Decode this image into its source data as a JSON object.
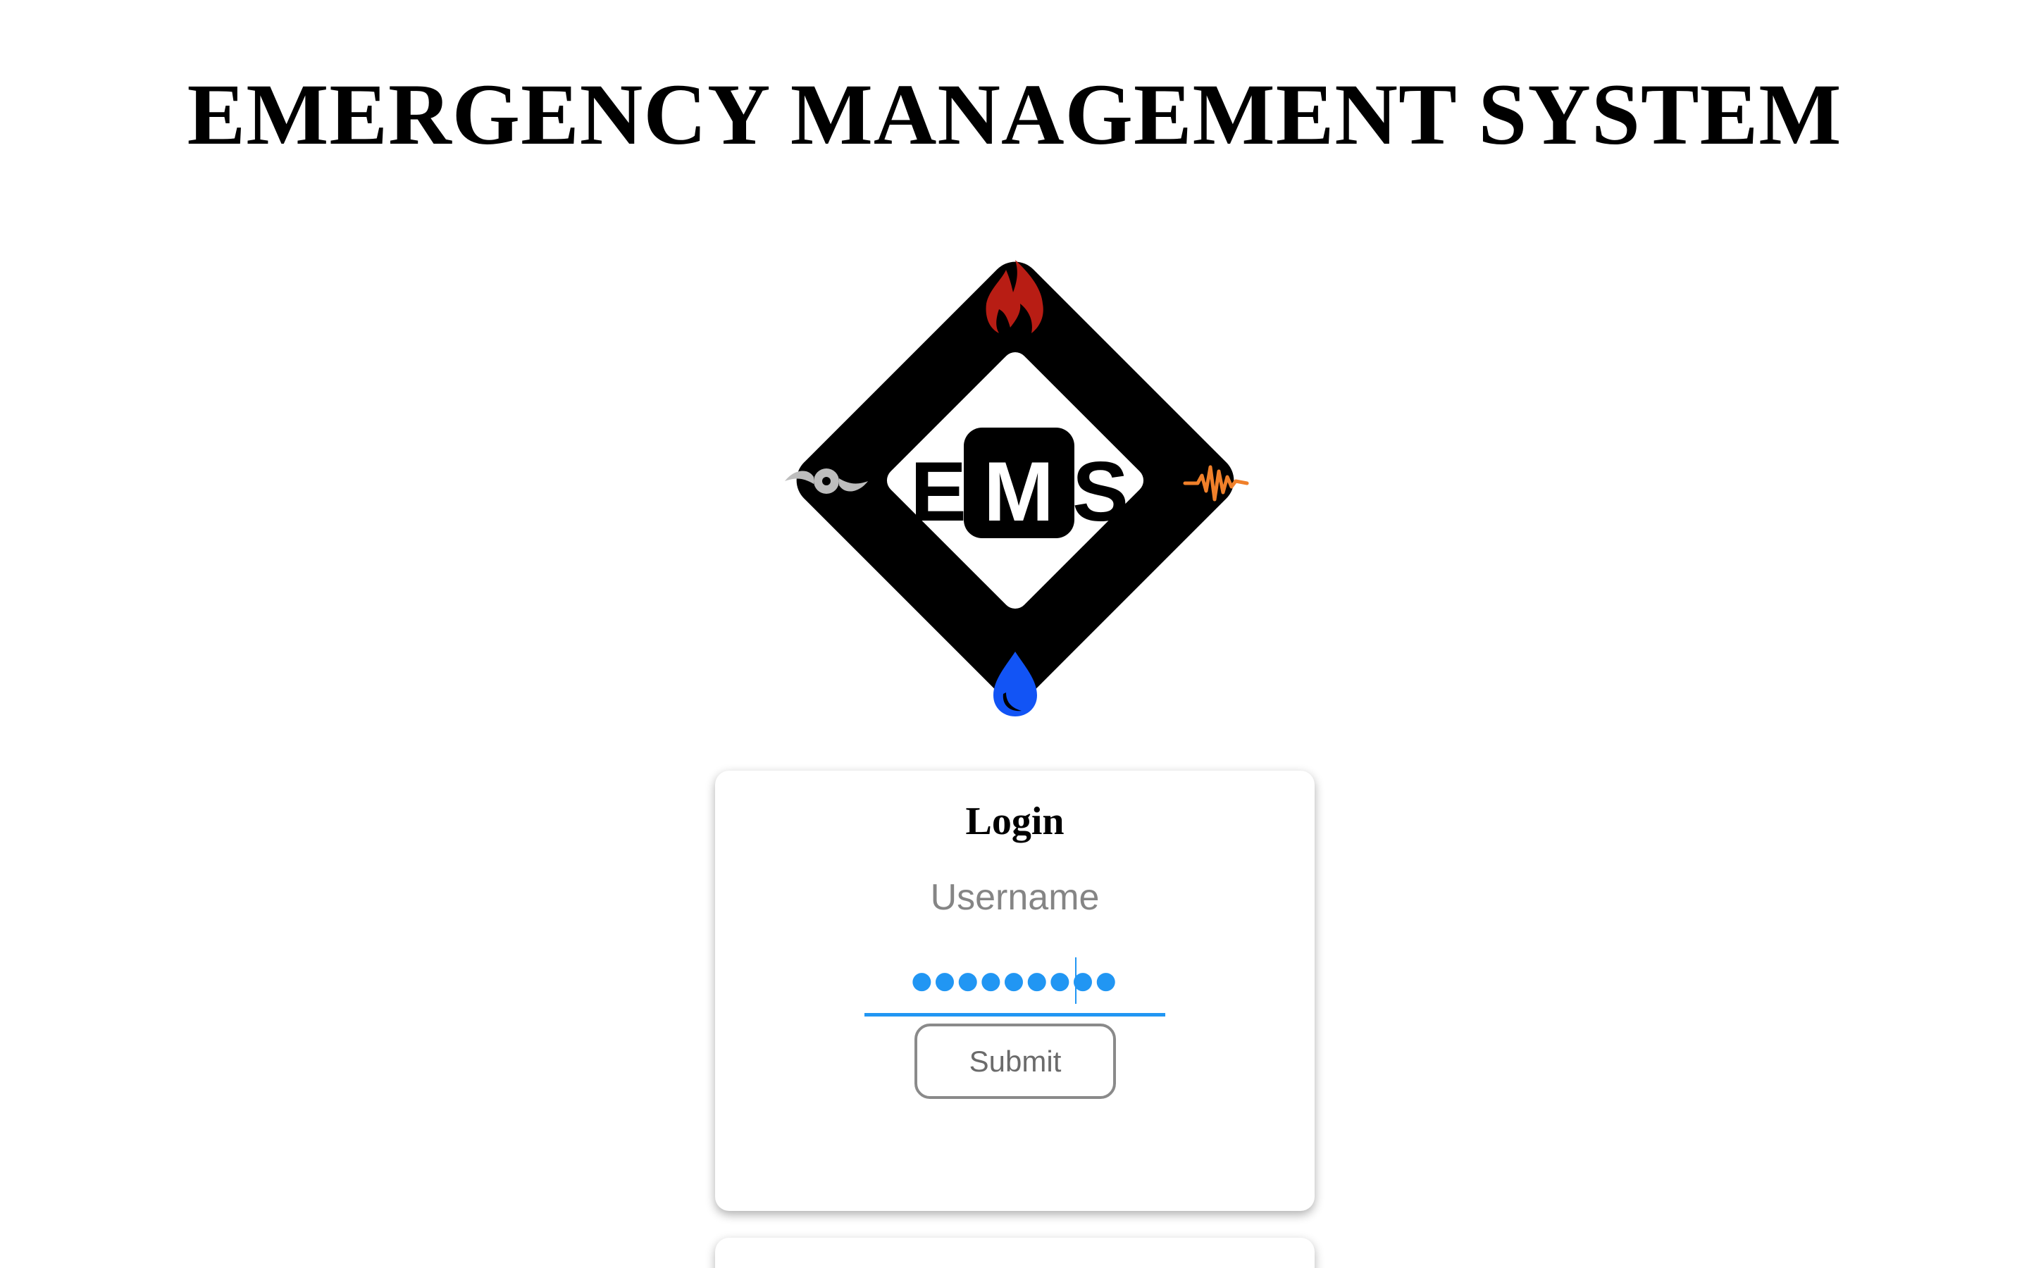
{
  "header": {
    "title": "EMERGENCY MANAGEMENT SYSTEM"
  },
  "logo": {
    "text_e": "E",
    "text_m": "M",
    "text_s": "S",
    "icons": {
      "top": "fire-icon",
      "left": "hurricane-icon",
      "right": "seismic-wave-icon",
      "bottom": "water-drop-icon"
    },
    "colors": {
      "frame": "#000000",
      "fire": "#b81d14",
      "hurricane": "#bdbdbd",
      "seismic": "#f0802a",
      "water": "#1254f5"
    }
  },
  "login": {
    "title": "Login",
    "username": {
      "placeholder": "Username",
      "value": ""
    },
    "password": {
      "masked_value": "●●●●●●●●●"
    },
    "submit_label": "Submit",
    "focus_color": "#2196f3"
  }
}
